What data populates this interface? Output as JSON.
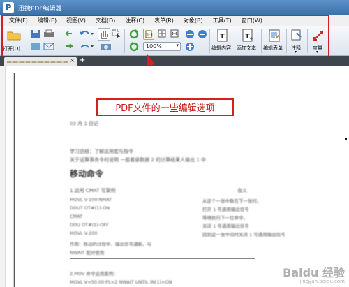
{
  "app": {
    "title": "迅捷PDF编辑器",
    "logo_letter": "P"
  },
  "menu": [
    "文件(F)",
    "编辑(E)",
    "视图(V)",
    "文档(D)",
    "注释(C)",
    "表单(R)",
    "对象(B)",
    "工具(T)",
    "窗口(W)"
  ],
  "toolbar": {
    "open_label": "打开(O)...",
    "zoom_value": "100%",
    "edit_content_label": "编辑内容",
    "add_text_label": "添加文本",
    "edit_form_label": "编辑表单",
    "annotate_label": "注释",
    "measure_label": "度量"
  },
  "callout": "PDF文件的一些编辑选项",
  "document": {
    "date_line": "03 月 1 日记",
    "line1": "学习总结：了解运用宏与指令",
    "line2": "关于运算事务令的说明 一般着装数据 2 的计算结果人输出 1 中",
    "heading": "移动命令",
    "table_header_left": "1.运用 CMAT 写案例",
    "table_header_right": "含义",
    "rows": [
      {
        "left": "MOVL V-100:NMAT",
        "right": "从这个一张中数在下一张时。"
      },
      {
        "left": "DOUT OT#(1)-ON",
        "right": "打开 1 号通用输出信号"
      },
      {
        "left": "CMAT",
        "right": "等待执行下一位命令。"
      },
      {
        "left": "DOU OT#(1)-OFF",
        "right": "关闭 1 号通用输出信号"
      },
      {
        "left": "MOVL V-100",
        "right": "回到这一张中间时关闭 1 号通用输出信号"
      }
    ],
    "note_line": "作用：移动的过程中，输出信号通断。与",
    "note_line2": "NWAIT 配对使用",
    "section2": "2.MOV 命令运用案例：",
    "last_line": "MOVL   V=50.00   PL=2   NWAIT   UNTIL   IN(1)=ON"
  },
  "watermark": {
    "brand": "Baidu 经验",
    "url": "jingyan.baidu.com"
  },
  "colors": {
    "highlight": "#d42020",
    "titlebar": "#3c6fa8",
    "tabbar": "#3f454d"
  }
}
